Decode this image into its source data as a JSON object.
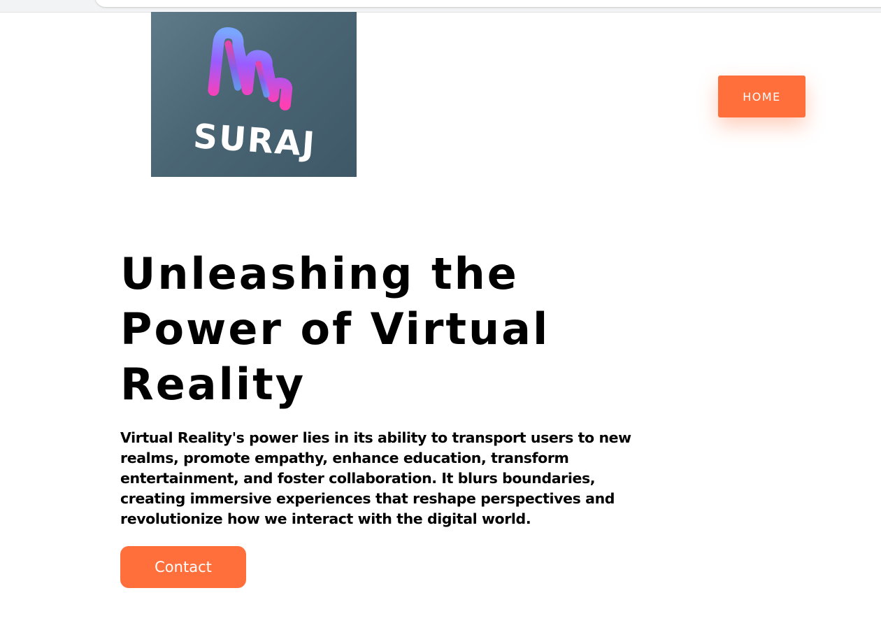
{
  "logo": {
    "text": "SURAJ",
    "icon": "gradient-wave-icon",
    "colors": {
      "tile": "#4a6574",
      "wave_pink": "#ff3fb4",
      "wave_blue": "#5b8cff",
      "text": "#ffffff"
    }
  },
  "nav": {
    "home_label": "HOME"
  },
  "hero": {
    "title": "Unleashing the Power of Virtual Reality",
    "description": "Virtual Reality's power lies in its ability to transport users to new realms, promote empathy, enhance education, transform entertainment, and foster collaboration. It blurs boundaries, creating immersive experiences that reshape perspectives and revolutionize how we interact with the digital world.",
    "contact_label": "Contact"
  },
  "colors": {
    "accent": "#ff6f3c",
    "background": "#ffffff",
    "text": "#000000"
  }
}
